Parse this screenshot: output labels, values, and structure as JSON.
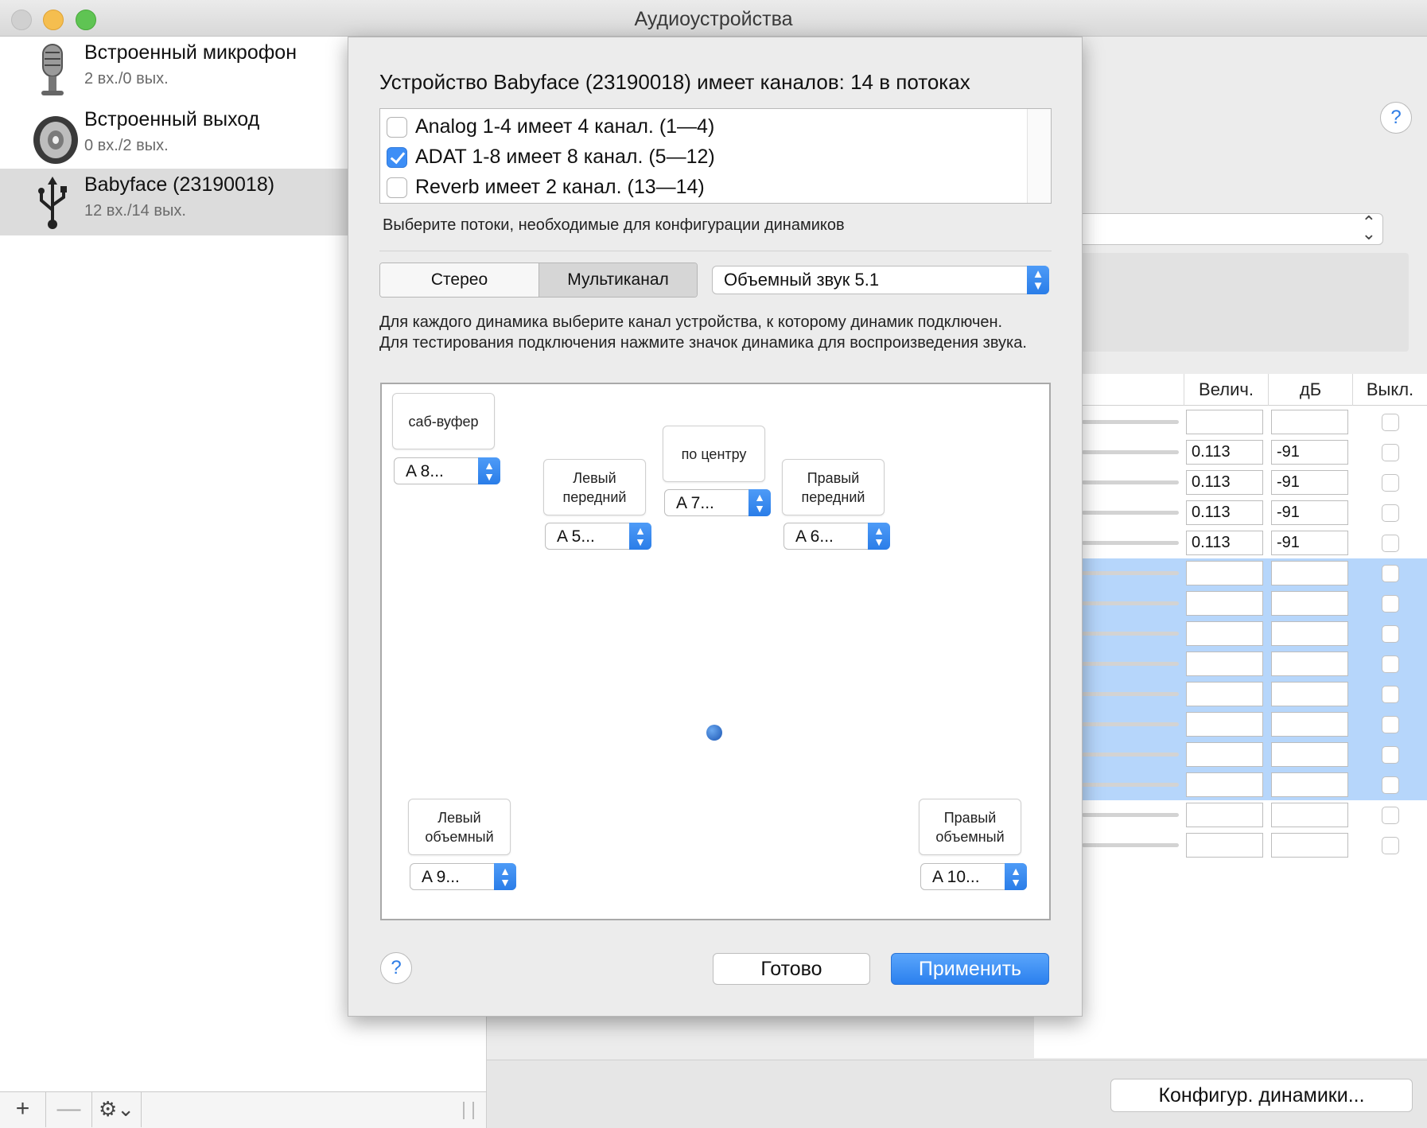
{
  "window": {
    "title": "Аудиоустройства"
  },
  "sidebar": {
    "devices": [
      {
        "name": "Встроенный микрофон",
        "io": "2 вх./0 вых.",
        "icon": "microphone-icon"
      },
      {
        "name": "Встроенный выход",
        "io": "0 вх./2 вых.",
        "icon": "speaker-icon"
      },
      {
        "name": "Babyface (23190018)",
        "io": "12 вх./14 вых.",
        "icon": "usb-icon"
      }
    ],
    "add_label": "+",
    "remove_label": "—",
    "gear_label": "⚙︎⌄"
  },
  "right": {
    "help_label": "?",
    "columns": [
      "Велич.",
      "дБ",
      "Выкл."
    ],
    "rows": [
      {
        "value": "",
        "db": ""
      },
      {
        "value": "0.113",
        "db": "-91"
      },
      {
        "value": "0.113",
        "db": "-91"
      },
      {
        "value": "0.113",
        "db": "-91"
      },
      {
        "value": "0.113",
        "db": "-91"
      }
    ],
    "configure_speakers_label": "Конфигур. динамики..."
  },
  "sheet": {
    "title": "Устройство Babyface (23190018) имеет каналов: 14 в потоках",
    "streams": [
      {
        "label": "Analog 1-4 имеет 4 канал. (1—4)",
        "checked": false
      },
      {
        "label": "ADAT 1-8 имеет 8 канал. (5—12)",
        "checked": true
      },
      {
        "label": "Reverb имеет 2 канал. (13—14)",
        "checked": false
      }
    ],
    "streams_hint": "Выберите потоки, необходимые для конфигурации динамиков",
    "mode_stereo": "Стерео",
    "mode_multichannel": "Мультиканал",
    "format_value": "Объемный звук 5.1",
    "instructions": "Для каждого динамика выберите канал устройства, к которому динамик подключен. Для тестирования подключения нажмите значок динамика для воспроизведения звука.",
    "speakers": {
      "subwoofer": {
        "label": "саб-вуфер",
        "channel": "A   8..."
      },
      "front_left": {
        "label": "Левый передний",
        "channel": "A   5..."
      },
      "center": {
        "label": "по центру",
        "channel": "A   7..."
      },
      "front_right": {
        "label": "Правый передний",
        "channel": "A   6..."
      },
      "surround_left": {
        "label": "Левый объемный",
        "channel": "A   9..."
      },
      "surround_right": {
        "label": "Правый объемный",
        "channel": "A  10..."
      }
    },
    "help_label": "?",
    "done_label": "Готово",
    "apply_label": "Применить"
  }
}
